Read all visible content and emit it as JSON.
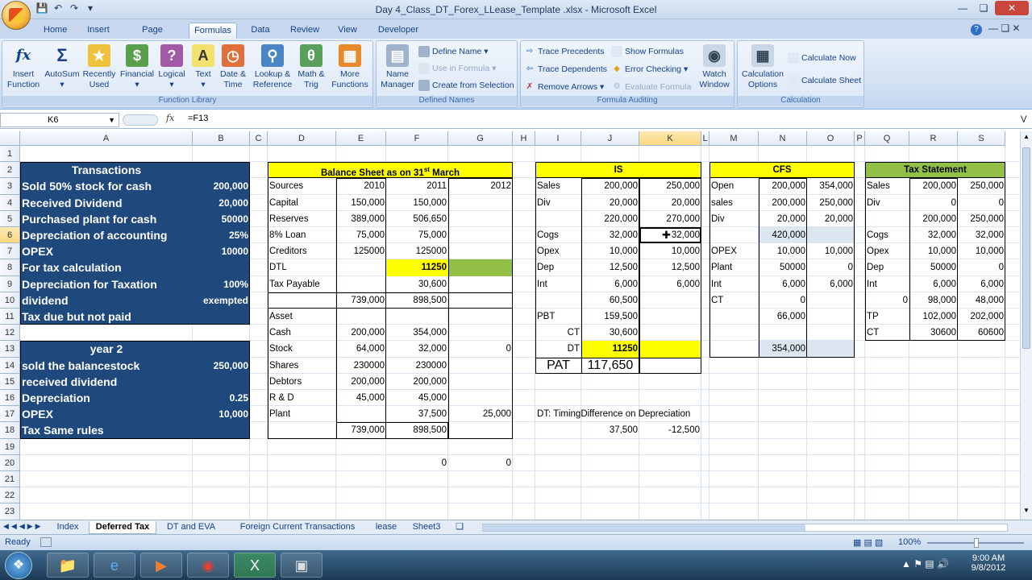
{
  "window": {
    "title": "Day 4_Class_DT_Forex_LLease_Template .xlsx - Microsoft Excel"
  },
  "ribbon_tabs": [
    "Home",
    "Insert",
    "Page Layout",
    "Formulas",
    "Data",
    "Review",
    "View",
    "Developer"
  ],
  "active_tab": "Formulas",
  "function_library": {
    "label": "Function Library",
    "buttons": [
      [
        "Insert",
        "Function"
      ],
      [
        "AutoSum",
        ""
      ],
      [
        "Recently",
        "Used"
      ],
      [
        "Financial",
        ""
      ],
      [
        "Logical",
        ""
      ],
      [
        "Text",
        ""
      ],
      [
        "Date &",
        "Time"
      ],
      [
        "Lookup &",
        "Reference"
      ],
      [
        "Math &",
        "Trig"
      ],
      [
        "More",
        "Functions"
      ]
    ]
  },
  "defined_names": {
    "label": "Defined Names",
    "name_manager": [
      "Name",
      "Manager"
    ],
    "define_name": "Define Name",
    "use_in_formula": "Use in Formula",
    "create_from_selection": "Create from Selection"
  },
  "formula_auditing": {
    "label": "Formula Auditing",
    "trace_precedents": "Trace Precedents",
    "trace_dependents": "Trace Dependents",
    "remove_arrows": "Remove Arrows",
    "show_formulas": "Show Formulas",
    "error_checking": "Error Checking",
    "evaluate_formula": "Evaluate Formula",
    "watch_window": [
      "Watch",
      "Window"
    ]
  },
  "calculation": {
    "label": "Calculation",
    "options": [
      "Calculation",
      "Options"
    ],
    "calc_now": "Calculate Now",
    "calc_sheet": "Calculate Sheet"
  },
  "formula_bar": {
    "name_box": "K6",
    "fx": "fx",
    "formula": "=F13"
  },
  "columns": [
    "A",
    "B",
    "C",
    "D",
    "E",
    "F",
    "G",
    "H",
    "I",
    "J",
    "K",
    "L",
    "M",
    "N",
    "O",
    "P",
    "Q",
    "R",
    "S"
  ],
  "rows": [
    "1",
    "2",
    "3",
    "4",
    "5",
    "6",
    "7",
    "8",
    "9",
    "10",
    "11",
    "12",
    "13",
    "14",
    "15",
    "16",
    "17",
    "18",
    "19",
    "20",
    "21",
    "22",
    "23"
  ],
  "cells": {
    "A2": "Transactions",
    "A3": "Sold 50% stock for cash",
    "B3": "200,000",
    "A4": "Received Dividend",
    "B4": "20,000",
    "A5": "Purchased plant for cash",
    "B5": "50000",
    "A6": "Depreciation of accounting",
    "B6": "25%",
    "A7": "OPEX",
    "B7": "10000",
    "A8": "For tax calculation",
    "A9": "Depreciation for Taxation",
    "B9": "100%",
    "A10": "dividend",
    "B10": "exempted",
    "A11": "Tax due but not paid",
    "A13": "year 2",
    "A14": "sold the balancestock",
    "B14": "250,000",
    "A15": "received dividend",
    "A16": "Depreciation",
    "B16": "0.25",
    "A17": "OPEX",
    "B17": "10,000",
    "A18": "Tax Same rules",
    "D2": "Balance Sheet as on 31",
    "D2sup": "st",
    "D2b": " March",
    "D3": "Sources",
    "E3": "2010",
    "F3": "2011",
    "G3": "2012",
    "D4": "Capital",
    "E4": "150,000",
    "F4": "150,000",
    "D5": "Reserves",
    "E5": "389,000",
    "F5": "506,650",
    "D6": "8% Loan",
    "E6": "75,000",
    "F6": "75,000",
    "D7": "Creditors",
    "E7": "125000",
    "F7": "125000",
    "D8": "DTL",
    "F8": "11250",
    "D9": "Tax Payable",
    "F9": "30,600",
    "E10": "739,000",
    "F10": "898,500",
    "D11": "Asset",
    "D12": "Cash",
    "E12": "200,000",
    "F12": "354,000",
    "D13": "Stock",
    "E13": "64,000",
    "F13": "32,000",
    "G13": "0",
    "D14": "Shares",
    "E14": "230000",
    "F14": "230000",
    "D15": "Debtors",
    "E15": "200,000",
    "F15": "200,000",
    "D16": "R & D",
    "E16": "45,000",
    "F16": "45,000",
    "D17": "Plant",
    "F17": "37,500",
    "G17": "25,000",
    "E18": "739,000",
    "F18": "898,500",
    "F20": "0",
    "G20": "0",
    "I2": "IS",
    "I3": "Sales",
    "J3": "200,000",
    "K3": "250,000",
    "I4": "Div",
    "J4": "20,000",
    "K4": "20,000",
    "J5": "220,000",
    "K5": "270,000",
    "I6": "Cogs",
    "J6": "32,000",
    "K6": "32,000",
    "I7": "Opex",
    "J7": "10,000",
    "K7": "10,000",
    "I8": "Dep",
    "J8": "12,500",
    "K8": "12,500",
    "I9": "Int",
    "J9": "6,000",
    "K9": "6,000",
    "J10": "60,500",
    "I11": "PBT",
    "J11": "159,500",
    "I12": "CT",
    "J12": "30,600",
    "I13": "DT",
    "J13": "11250",
    "I14": "PAT",
    "J14": "117,650",
    "I17": "DT: TimingDifference on Depreciation",
    "J18": "37,500",
    "K18": "-12,500",
    "M2": "CFS",
    "M3": "Open",
    "N3": "200,000",
    "O3": "354,000",
    "M4": "sales",
    "N4": "200,000",
    "O4": "250,000",
    "M5": "Div",
    "N5": "20,000",
    "O5": "20,000",
    "N6": "420,000",
    "M7": "OPEX",
    "N7": "10,000",
    "O7": "10,000",
    "M8": "Plant",
    "N8": "50000",
    "O8": "0",
    "M9": "Int",
    "N9": "6,000",
    "O9": "6,000",
    "M10": "CT",
    "N10": "0",
    "N11": "66,000",
    "N13": "354,000",
    "Q2": "Tax Statement",
    "Q3": "Sales",
    "R3": "200,000",
    "S3": "250,000",
    "Q4": "Div",
    "R4": "0",
    "S4": "0",
    "R5": "200,000",
    "S5": "250,000",
    "Q6": "Cogs",
    "R6": "32,000",
    "S6": "32,000",
    "Q7": "Opex",
    "R7": "10,000",
    "S7": "10,000",
    "Q8": "Dep",
    "R8": "50000",
    "S8": "0",
    "Q9": "Int",
    "R9": "6,000",
    "S9": "6,000",
    "Q10": "0",
    "R10": "98,000",
    "S10": "48,000",
    "Q11": "TP",
    "R11": "102,000",
    "S11": "202,000",
    "Q12": "CT",
    "R12": "30600",
    "S12": "60600"
  },
  "sheet_tabs": [
    "Index",
    "Deferred Tax",
    "DT and EVA",
    "Foreign Current Transactions",
    "lease",
    "Sheet3"
  ],
  "active_sheet": "Deferred Tax",
  "status": {
    "ready": "Ready",
    "zoom": "100%"
  },
  "clock": {
    "time": "9:00 AM",
    "date": "9/8/2012"
  },
  "colors": {
    "navy": "#1f497d",
    "yellow": "#ffff00",
    "green": "#92c047",
    "light": "#dce6f1"
  }
}
